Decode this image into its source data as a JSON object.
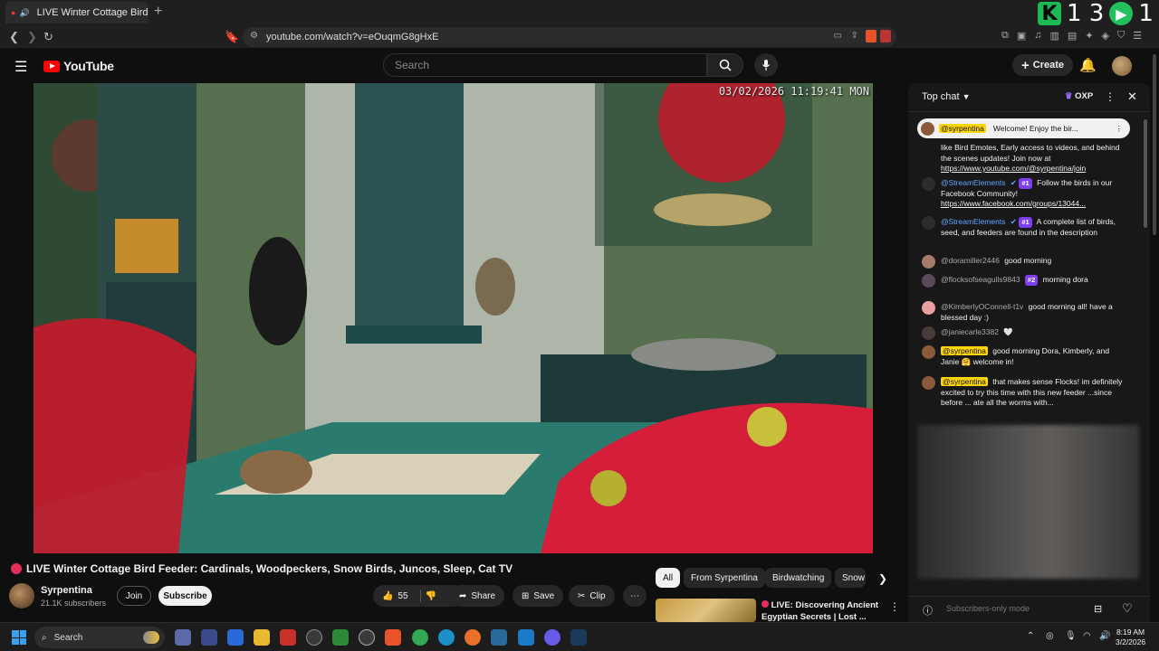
{
  "browser": {
    "tab_title": "LIVE Winter Cottage Bird F",
    "tab_close": "✕",
    "new_tab": "+",
    "url": "youtube.com/watch?v=eOuqmG8gHxE",
    "overlay_counter": "1 3",
    "overlay_right": "1"
  },
  "header": {
    "logo_text": "YouTube",
    "search_placeholder": "Search",
    "create_label": "Create"
  },
  "video": {
    "timestamp": "03/02/2026 11:19:41 MON",
    "title": "LIVE Winter Cottage Bird Feeder: Cardinals, Woodpeckers, Snow Birds, Juncos, Sleep, Cat TV"
  },
  "channel": {
    "name": "Syrpentina",
    "subscribers": "21.1K subscribers",
    "join_label": "Join",
    "subscribe_label": "Subscribe"
  },
  "actions": {
    "likes": "55",
    "share_label": "Share",
    "save_label": "Save",
    "clip_label": "Clip"
  },
  "chips": [
    "All",
    "From Syrpentina",
    "Birdwatching",
    "Snow"
  ],
  "recommended": {
    "title": "LIVE: Discovering Ancient Egyptian Secrets | Lost ..."
  },
  "chat": {
    "header_title": "Top chat",
    "oxp_label": "OXP",
    "pinned_author": "@syrpentina",
    "pinned_text": "Welcome! Enjoy the bir...",
    "messages": [
      {
        "author": "",
        "text": "like Bird Emotes, Early access to videos, and behind the scenes updates! Join now at ",
        "link": "https://www.youtube.com/@syrpentina/join",
        "badge": "",
        "owner": false
      },
      {
        "author": "@StreamElements",
        "text": "Follow the birds in our Facebook Community! ",
        "link": "https://www.facebook.com/groups/13044...",
        "badge": "#1",
        "owner": false
      },
      {
        "author": "@StreamElements",
        "text": "A complete list of birds, seed, and feeders are found in the description",
        "link": "",
        "badge": "#1",
        "owner": false
      },
      {
        "author": "@doramiller2446",
        "text": "good morning",
        "link": "",
        "badge": "",
        "owner": false
      },
      {
        "author": "@flocksofseagulls9843",
        "text": "morning dora",
        "link": "",
        "badge": "#2",
        "owner": false
      },
      {
        "author": "@KimberlyOConnell-t1v",
        "text": "good morning all! have a blessed day :)",
        "link": "",
        "badge": "",
        "owner": false
      },
      {
        "author": "@janiecarle3382",
        "text": "🤍",
        "link": "",
        "badge": "",
        "owner": false
      },
      {
        "author": "@syrpentina",
        "text": "good morning Dora, Kimberly, and Janie 🤗 welcome in!",
        "link": "",
        "badge": "",
        "owner": true
      },
      {
        "author": "@syrpentina",
        "text": "that makes sense Flocks! im definitely excited to try this time with this new feeder ...since before ... ate all the worms with...",
        "link": "",
        "badge": "",
        "owner": true
      }
    ],
    "footer_placeholder": "Subscribers-only mode"
  },
  "taskbar": {
    "search_label": "Search",
    "time": "8:19 AM",
    "date": "3/2/2026"
  }
}
